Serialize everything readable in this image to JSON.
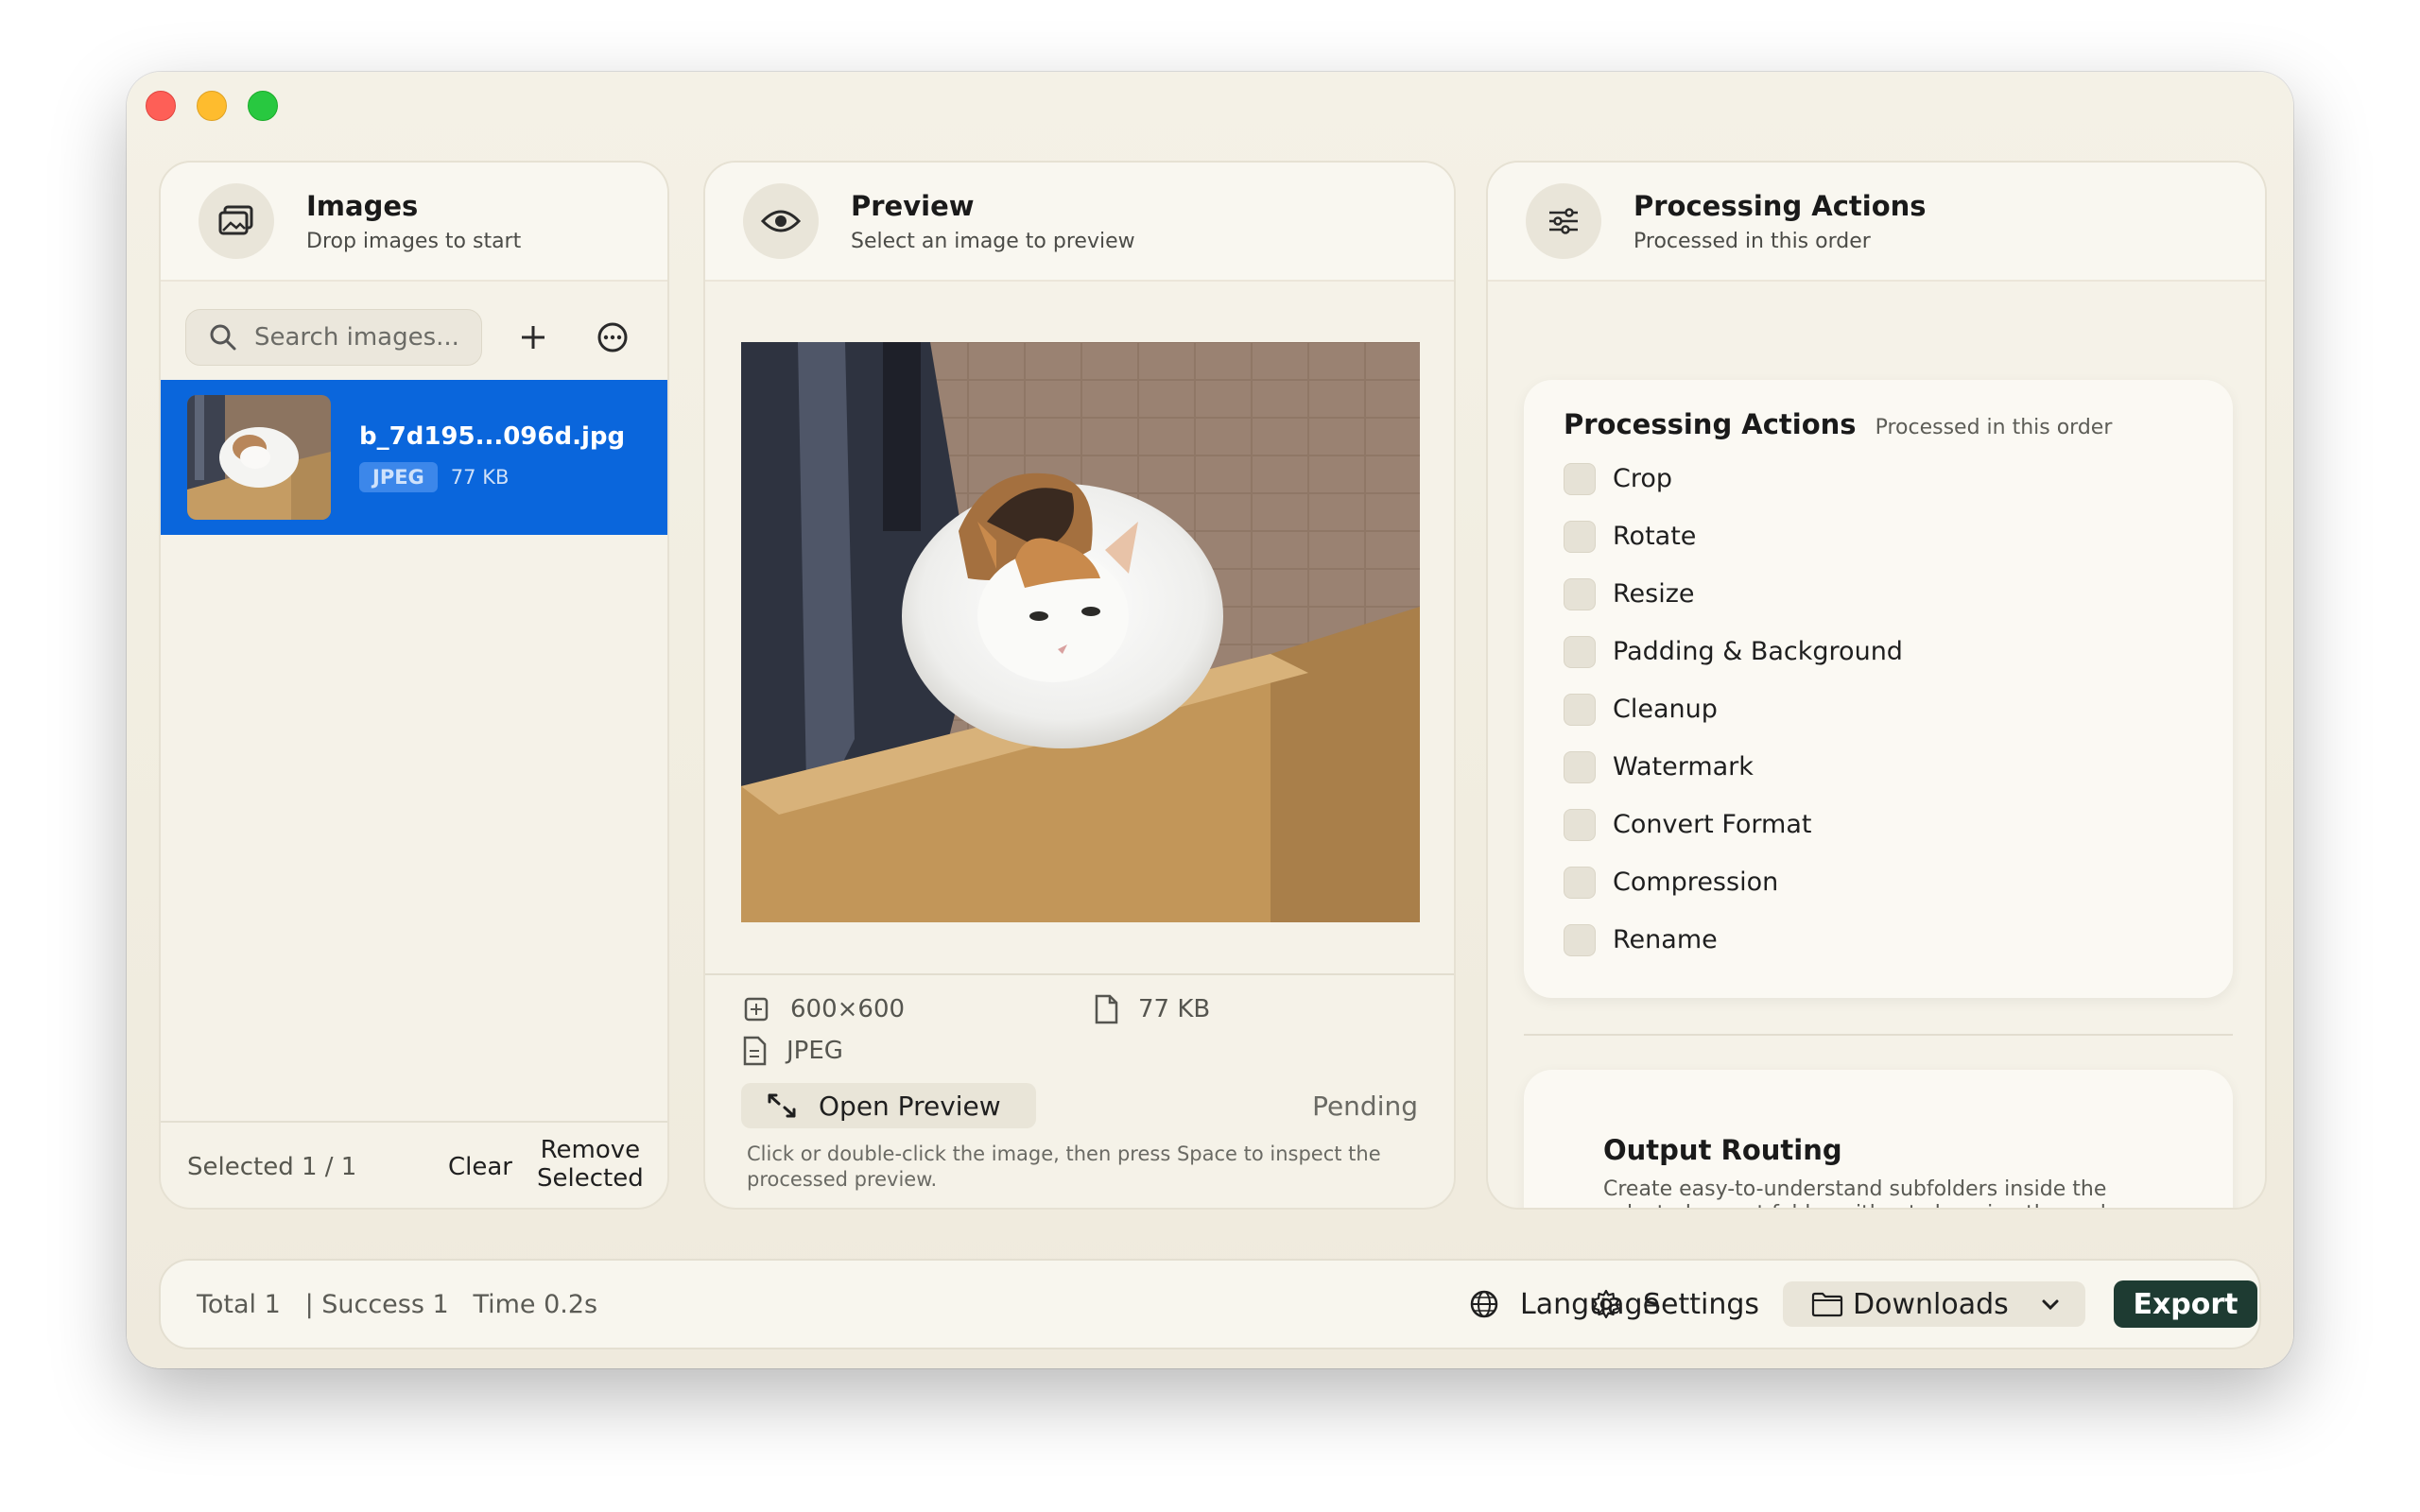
{
  "window": {
    "controls": [
      "close",
      "minimize",
      "zoom"
    ]
  },
  "images_panel": {
    "title": "Images",
    "subtitle": "Drop images to start",
    "icon": "photos-icon",
    "search": {
      "placeholder": "Search images..."
    },
    "items": [
      {
        "name": "b_7d195...096d.jpg",
        "format": "JPEG",
        "size": "77 KB",
        "selected": true
      }
    ],
    "footer": {
      "selected": "Selected 1 / 1",
      "clear": "Clear",
      "remove_line1": "Remove",
      "remove_line2": "Selected"
    }
  },
  "preview_panel": {
    "title": "Preview",
    "subtitle": "Select an image to preview",
    "icon": "eye-icon",
    "dimensions": "600×600",
    "file_size": "77 KB",
    "format": "JPEG",
    "open_button": "Open Preview",
    "status": "Pending",
    "hint": "Click or double-click the image, then press Space to inspect the processed preview."
  },
  "processing_panel": {
    "title": "Processing Actions",
    "subtitle": "Processed in this order",
    "icon": "sliders-icon",
    "card": {
      "title": "Processing Actions",
      "subtitle": "Processed in this order",
      "actions": [
        {
          "label": "Crop",
          "checked": false
        },
        {
          "label": "Rotate",
          "checked": false
        },
        {
          "label": "Resize",
          "checked": false
        },
        {
          "label": "Padding & Background",
          "checked": false
        },
        {
          "label": "Cleanup",
          "checked": false
        },
        {
          "label": "Watermark",
          "checked": false
        },
        {
          "label": "Convert Format",
          "checked": false
        },
        {
          "label": "Compression",
          "checked": false
        },
        {
          "label": "Rename",
          "checked": false
        }
      ]
    },
    "output_routing": {
      "title": "Output Routing",
      "description": "Create easy-to-understand subfolders inside the selected export folder without changing the real export destination."
    }
  },
  "bottom_bar": {
    "stats": "Total 1   | Success 1   Time 0.2s",
    "language": "Language",
    "settings": "Settings",
    "folder": "Downloads",
    "export": "Export"
  },
  "colors": {
    "selection": "#0a66dc",
    "export_button": "#1e3b32",
    "window_bg": "#f4f1e6"
  }
}
